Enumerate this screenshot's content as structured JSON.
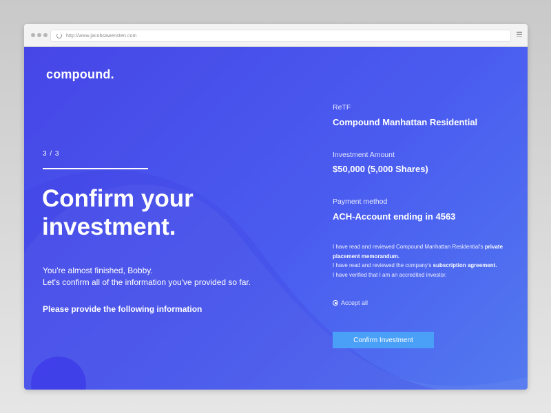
{
  "browser": {
    "url": "http://www.jacobsawensten.com"
  },
  "brand": {
    "logo": "compound."
  },
  "left": {
    "step": "3 / 3",
    "title_line1": "Confirm your",
    "title_line2": "investment.",
    "intro_line1": "You're almost finished, Bobby.",
    "intro_line2": "Let's confirm all of the information you've provided so far.",
    "provide": "Please provide the following information"
  },
  "details": {
    "retf_label": "ReTF",
    "retf_value": "Compound Manhattan Residential",
    "amount_label": "Investment Amount",
    "amount_value": "$50,000 (5,000 Shares)",
    "payment_label": "Payment method",
    "payment_value": "ACH-Account ending in 4563"
  },
  "terms": {
    "line1_prefix": "I have read and reviewed Compound Manhattan Residential's ",
    "line1_bold": "private placement memorandum.",
    "line2_prefix": "I have read and reviewed the company's ",
    "line2_bold": "subscription agreement.",
    "line3": "I have verified that I am an accredited investor."
  },
  "accept_label": "Accept all",
  "confirm_label": "Confirm Investment",
  "colors": {
    "background_start": "#4646e6",
    "background_end": "#5279ef",
    "button": "#4aa0f6"
  }
}
